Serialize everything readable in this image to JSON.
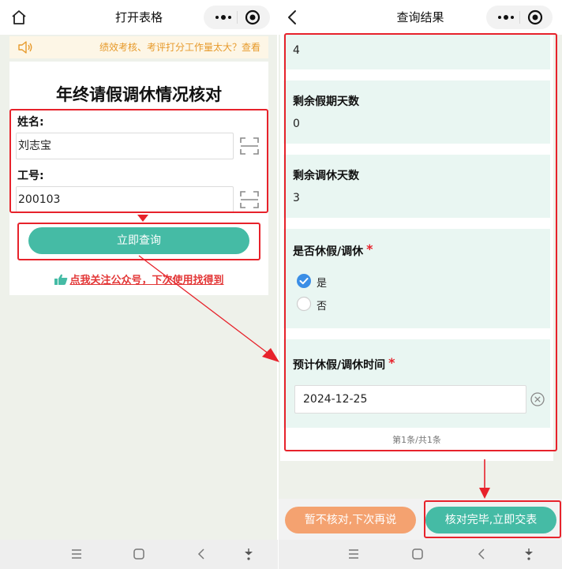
{
  "left_screen": {
    "nav": {
      "title": "打开表格",
      "home_icon": "home-icon",
      "more_icon": "more-dots-icon",
      "close_icon": "target-icon"
    },
    "notice": {
      "icon": "speaker-icon",
      "text": "绩效考核、考评打分工作量太大？查看"
    },
    "form": {
      "title": "年终请假调休情况核对",
      "name_label": "姓名:",
      "name_value": "刘志宝",
      "id_label": "工号:",
      "id_value": "200103",
      "scan_icon": "scan-icon",
      "query_button": "立即查询",
      "follow_text": "点我关注公众号，下次使用找得到",
      "follow_icon": "pointing-hand-icon"
    }
  },
  "right_screen": {
    "nav": {
      "title": "查询结果",
      "back_icon": "back-icon",
      "more_icon": "more-dots-icon",
      "close_icon": "target-icon"
    },
    "top_value": "4",
    "fields": [
      {
        "label": "剩余假期天数",
        "value": "0"
      },
      {
        "label": "剩余调休天数",
        "value": "3"
      }
    ],
    "leave_question": {
      "label": "是否休假/调休",
      "required_mark": "*",
      "options": [
        {
          "label": "是",
          "selected": true
        },
        {
          "label": "否",
          "selected": false
        }
      ]
    },
    "planned_time": {
      "label": "预计休假/调休时间",
      "required_mark": "*",
      "value": "2024-12-25",
      "clear_icon": "clear-icon"
    },
    "pager": "第1条/共1条",
    "buttons": {
      "later": "暂不核对,下次再说",
      "submit": "核对完毕,立即交表"
    }
  },
  "system_nav": [
    "menu-icon",
    "home-square-icon",
    "back-triangle-icon",
    "dropdown-icon"
  ],
  "colors": {
    "accent": "#45bba5",
    "orange": "#f4a270",
    "highlight_red": "#e7222b",
    "notice_text": "#e79a2b",
    "page_bg": "#eef1ea",
    "radio_selected": "#3a8ee6"
  }
}
